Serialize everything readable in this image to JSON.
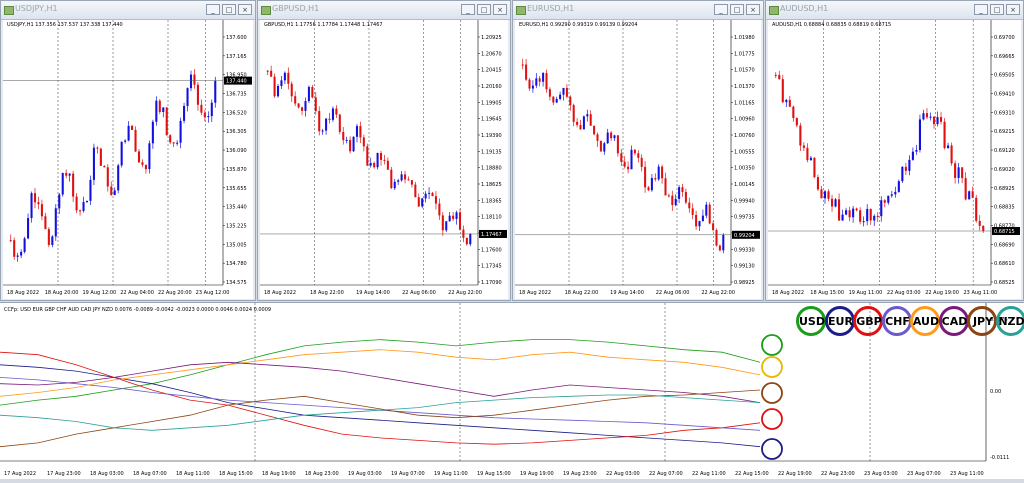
{
  "windows": [
    {
      "id": "usdjpy",
      "title": "USDJPY,H1",
      "ohlc": "USDJPY,H1 137.356 137.537 137.338 137.440",
      "last": "137.440",
      "y_labels": [
        "137.600",
        "137.165",
        "136.950",
        "136.735",
        "136.520",
        "136.305",
        "136.090",
        "135.870",
        "135.655",
        "135.440",
        "135.225",
        "135.005",
        "134.780",
        "134.575"
      ],
      "x_labels": [
        "18 Aug 2022",
        "18 Aug 20:00",
        "19 Aug 12:00",
        "22 Aug 04:00",
        "22 Aug 20:00",
        "23 Aug 12:00"
      ],
      "trend": "up"
    },
    {
      "id": "gbpusd",
      "title": "GBPUSD,H1",
      "ohlc": "GBPUSD,H1 1.17756 1.17784 1.17448 1.17467",
      "last": "1.17467",
      "y_labels": [
        "1.20925",
        "1.20670",
        "1.20415",
        "1.20160",
        "1.19905",
        "1.19645",
        "1.19390",
        "1.19135",
        "1.18880",
        "1.18625",
        "1.18365",
        "1.18110",
        "1.17855",
        "1.17600",
        "1.17345",
        "1.17090"
      ],
      "x_labels": [
        "18 Aug 2022",
        "18 Aug 22:00",
        "19 Aug 14:00",
        "22 Aug 06:00",
        "22 Aug 22:00"
      ],
      "trend": "down"
    },
    {
      "id": "eurusd",
      "title": "EURUSD,H1",
      "ohlc": "EURUSD,H1 0.99290 0.99319 0.99139 0.99204",
      "last": "0.99204",
      "y_labels": [
        "1.01980",
        "1.01775",
        "1.01570",
        "1.01370",
        "1.01165",
        "1.00960",
        "1.00760",
        "1.00555",
        "1.00350",
        "1.00145",
        "0.99940",
        "0.99735",
        "0.99535",
        "0.99330",
        "0.99130",
        "0.98925"
      ],
      "x_labels": [
        "18 Aug 2022",
        "18 Aug 22:00",
        "19 Aug 14:00",
        "22 Aug 06:00",
        "22 Aug 22:00"
      ],
      "trend": "down"
    },
    {
      "id": "audusd",
      "title": "AUDUSD,H1",
      "ohlc": "AUDUSD,H1 0.68884 0.68835 0.68819 0.68715",
      "last": "0.68715",
      "y_labels": [
        "0.69700",
        "0.69665",
        "0.69505",
        "0.69410",
        "0.69310",
        "0.69215",
        "0.69120",
        "0.69020",
        "0.68925",
        "0.68835",
        "0.68770",
        "0.68690",
        "0.68610",
        "0.68525"
      ],
      "x_labels": [
        "18 Aug 2022",
        "18 Aug 15:00",
        "19 Aug 11:00",
        "22 Aug 03:00",
        "22 Aug 19:00",
        "23 Aug 11:00"
      ],
      "trend": "mixed"
    }
  ],
  "buttons": {
    "minimize": "_",
    "maximize": "□",
    "close": "×"
  },
  "ccfp": {
    "label": "CCFp: USD EUR GBP CHF AUD CAD JPY NZD 0.0076 -0.0089 -0.0042 -0.0023 0.0000 0.0046 0.0024 0.0009",
    "y_labels": [
      "0.0076",
      "0.00",
      "-0.0111"
    ],
    "x_labels": [
      "17 Aug 2022",
      "17 Aug 23:00",
      "18 Aug 03:00",
      "18 Aug 07:00",
      "18 Aug 11:00",
      "18 Aug 15:00",
      "18 Aug 19:00",
      "18 Aug 23:00",
      "19 Aug 03:00",
      "19 Aug 07:00",
      "19 Aug 11:00",
      "19 Aug 15:00",
      "19 Aug 19:00",
      "19 Aug 23:00",
      "22 Aug 03:00",
      "22 Aug 07:00",
      "22 Aug 11:00",
      "22 Aug 15:00",
      "22 Aug 19:00",
      "22 Aug 23:00",
      "23 Aug 03:00",
      "23 Aug 07:00",
      "23 Aug 11:00"
    ],
    "currencies": [
      {
        "code": "USD",
        "color": "#1a9e1a"
      },
      {
        "code": "EUR",
        "color": "#1c1c8c"
      },
      {
        "code": "GBP",
        "color": "#e01010"
      },
      {
        "code": "CHF",
        "color": "#6a5acd"
      },
      {
        "code": "AUD",
        "color": "#ff9a1a"
      },
      {
        "code": "CAD",
        "color": "#7a1a7a"
      },
      {
        "code": "JPY",
        "color": "#8b4513"
      },
      {
        "code": "NZD",
        "color": "#2aa198"
      }
    ]
  }
}
